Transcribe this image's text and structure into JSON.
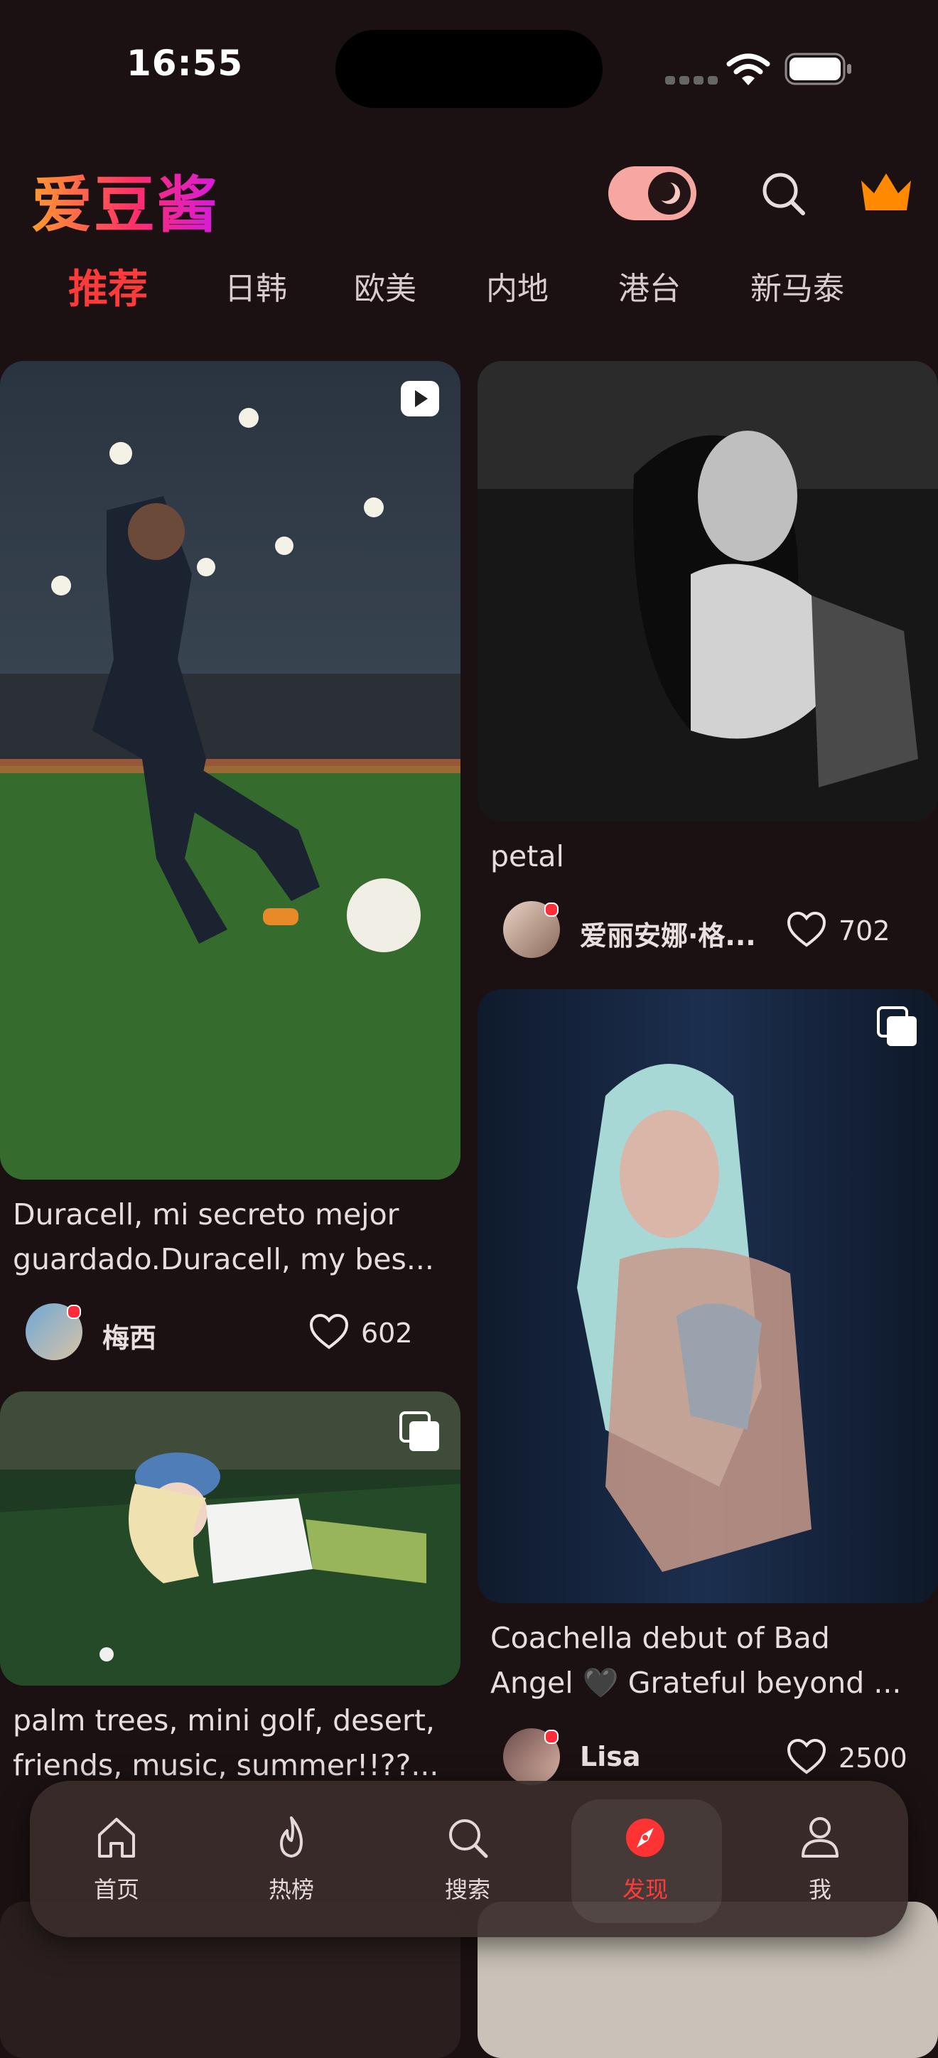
{
  "status_bar": {
    "time": "16:55"
  },
  "header": {
    "logo": "爱豆酱"
  },
  "tabs": [
    "推荐",
    "日韩",
    "欧美",
    "内地",
    "港台",
    "新马泰"
  ],
  "colors": {
    "accent": "#ff3a3a",
    "crown": "#ff8a00",
    "toggle": "#f6a7a2",
    "background": "#1b1112"
  },
  "feed": {
    "left": [
      {
        "caption_line1": "Duracell, mi secreto mejor",
        "caption_line2": "guardado.Duracell, my bes...",
        "author": "梅西",
        "likes": "602",
        "media_icon": "play-icon"
      },
      {
        "caption_line1": "palm trees, mini golf, desert,",
        "caption_line2": "friends, music, summer!!??...",
        "media_icon": "multi-image-icon"
      }
    ],
    "right": [
      {
        "caption_line1": "petal",
        "author": "爱丽安娜·格...",
        "likes": "702"
      },
      {
        "caption_line1": "Coachella debut of Bad",
        "caption_line2": "Angel 🖤  Grateful beyond ...",
        "author": "Lisa",
        "likes": "2500",
        "media_icon": "multi-image-icon"
      }
    ]
  },
  "nav": [
    {
      "label": "首页",
      "icon": "home-icon"
    },
    {
      "label": "热榜",
      "icon": "flame-icon"
    },
    {
      "label": "搜索",
      "icon": "search-icon"
    },
    {
      "label": "发现",
      "icon": "compass-icon",
      "active": true
    },
    {
      "label": "我",
      "icon": "profile-icon"
    }
  ]
}
